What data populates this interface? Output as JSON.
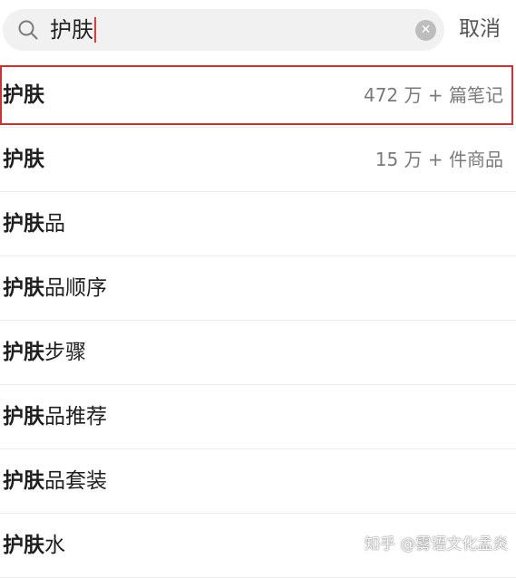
{
  "search": {
    "query": "护肤",
    "cancel_label": "取消",
    "clear_symbol": "✕"
  },
  "suggestions": [
    {
      "highlight": "护肤",
      "rest": "",
      "meta": "472 万 + 篇笔记"
    },
    {
      "highlight": "护肤",
      "rest": "",
      "meta": "15 万 + 件商品"
    },
    {
      "highlight": "护肤",
      "rest": "品",
      "meta": ""
    },
    {
      "highlight": "护肤",
      "rest": "品顺序",
      "meta": ""
    },
    {
      "highlight": "护肤",
      "rest": "步骤",
      "meta": ""
    },
    {
      "highlight": "护肤",
      "rest": "品推荐",
      "meta": ""
    },
    {
      "highlight": "护肤",
      "rest": "品套装",
      "meta": ""
    },
    {
      "highlight": "护肤",
      "rest": "水",
      "meta": ""
    }
  ],
  "watermark": "知乎 @雾语文化孟炎",
  "colors": {
    "highlight_border": "#d32f2f",
    "caret": "#e53935",
    "search_bg": "#f1f1f2"
  }
}
